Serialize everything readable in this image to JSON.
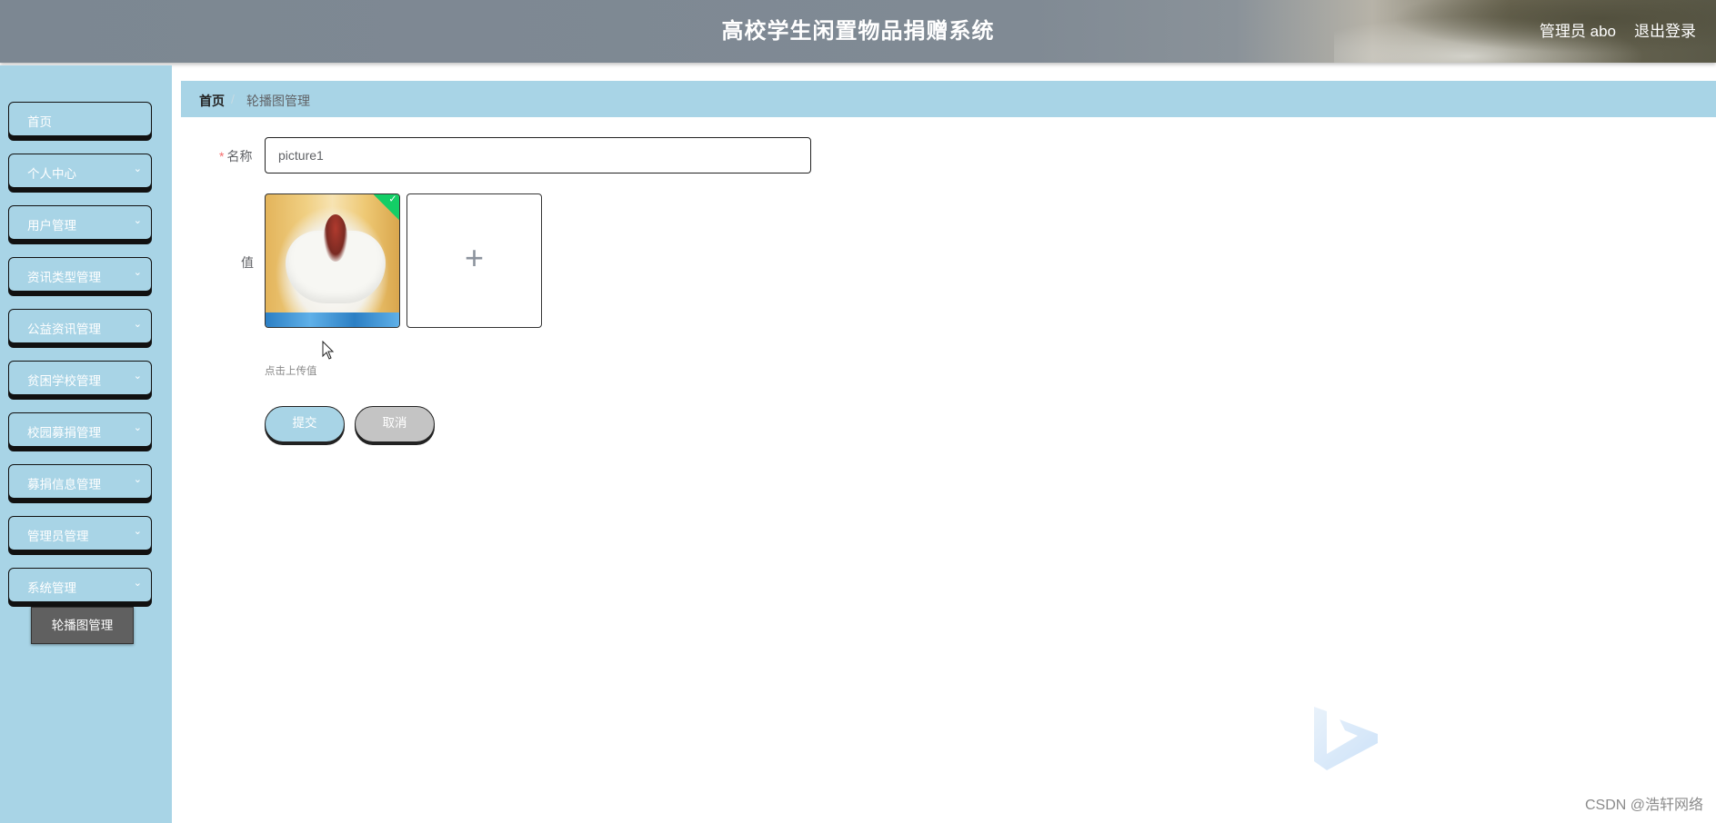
{
  "header": {
    "title": "高校学生闲置物品捐赠系统",
    "user_label": "管理员 abo",
    "logout_label": "退出登录"
  },
  "sidebar": {
    "items": [
      {
        "label": "首页",
        "has_chevron": false
      },
      {
        "label": "个人中心",
        "has_chevron": true
      },
      {
        "label": "用户管理",
        "has_chevron": true
      },
      {
        "label": "资讯类型管理",
        "has_chevron": true
      },
      {
        "label": "公益资讯管理",
        "has_chevron": true
      },
      {
        "label": "贫困学校管理",
        "has_chevron": true
      },
      {
        "label": "校园募捐管理",
        "has_chevron": true
      },
      {
        "label": "募捐信息管理",
        "has_chevron": true
      },
      {
        "label": "管理员管理",
        "has_chevron": true
      },
      {
        "label": "系统管理",
        "has_chevron": true
      }
    ],
    "active_submenu": "轮播图管理",
    "chevron_icon": "chevron-down-icon"
  },
  "breadcrumb": {
    "home": "首页",
    "separator": "/",
    "current": "轮播图管理"
  },
  "form": {
    "name_required_mark": "*",
    "name_label": "名称",
    "name_value": "picture1",
    "value_label": "值",
    "upload_hint": "点击上传值",
    "plus_symbol": "+",
    "submit_label": "提交",
    "cancel_label": "取消"
  },
  "watermark": "CSDN @浩轩网络",
  "colors": {
    "sidebar_bg": "#a8d4e6",
    "submenu_active_bg": "#606060",
    "success_badge": "#13ce66",
    "required_mark": "#f56c6c"
  }
}
